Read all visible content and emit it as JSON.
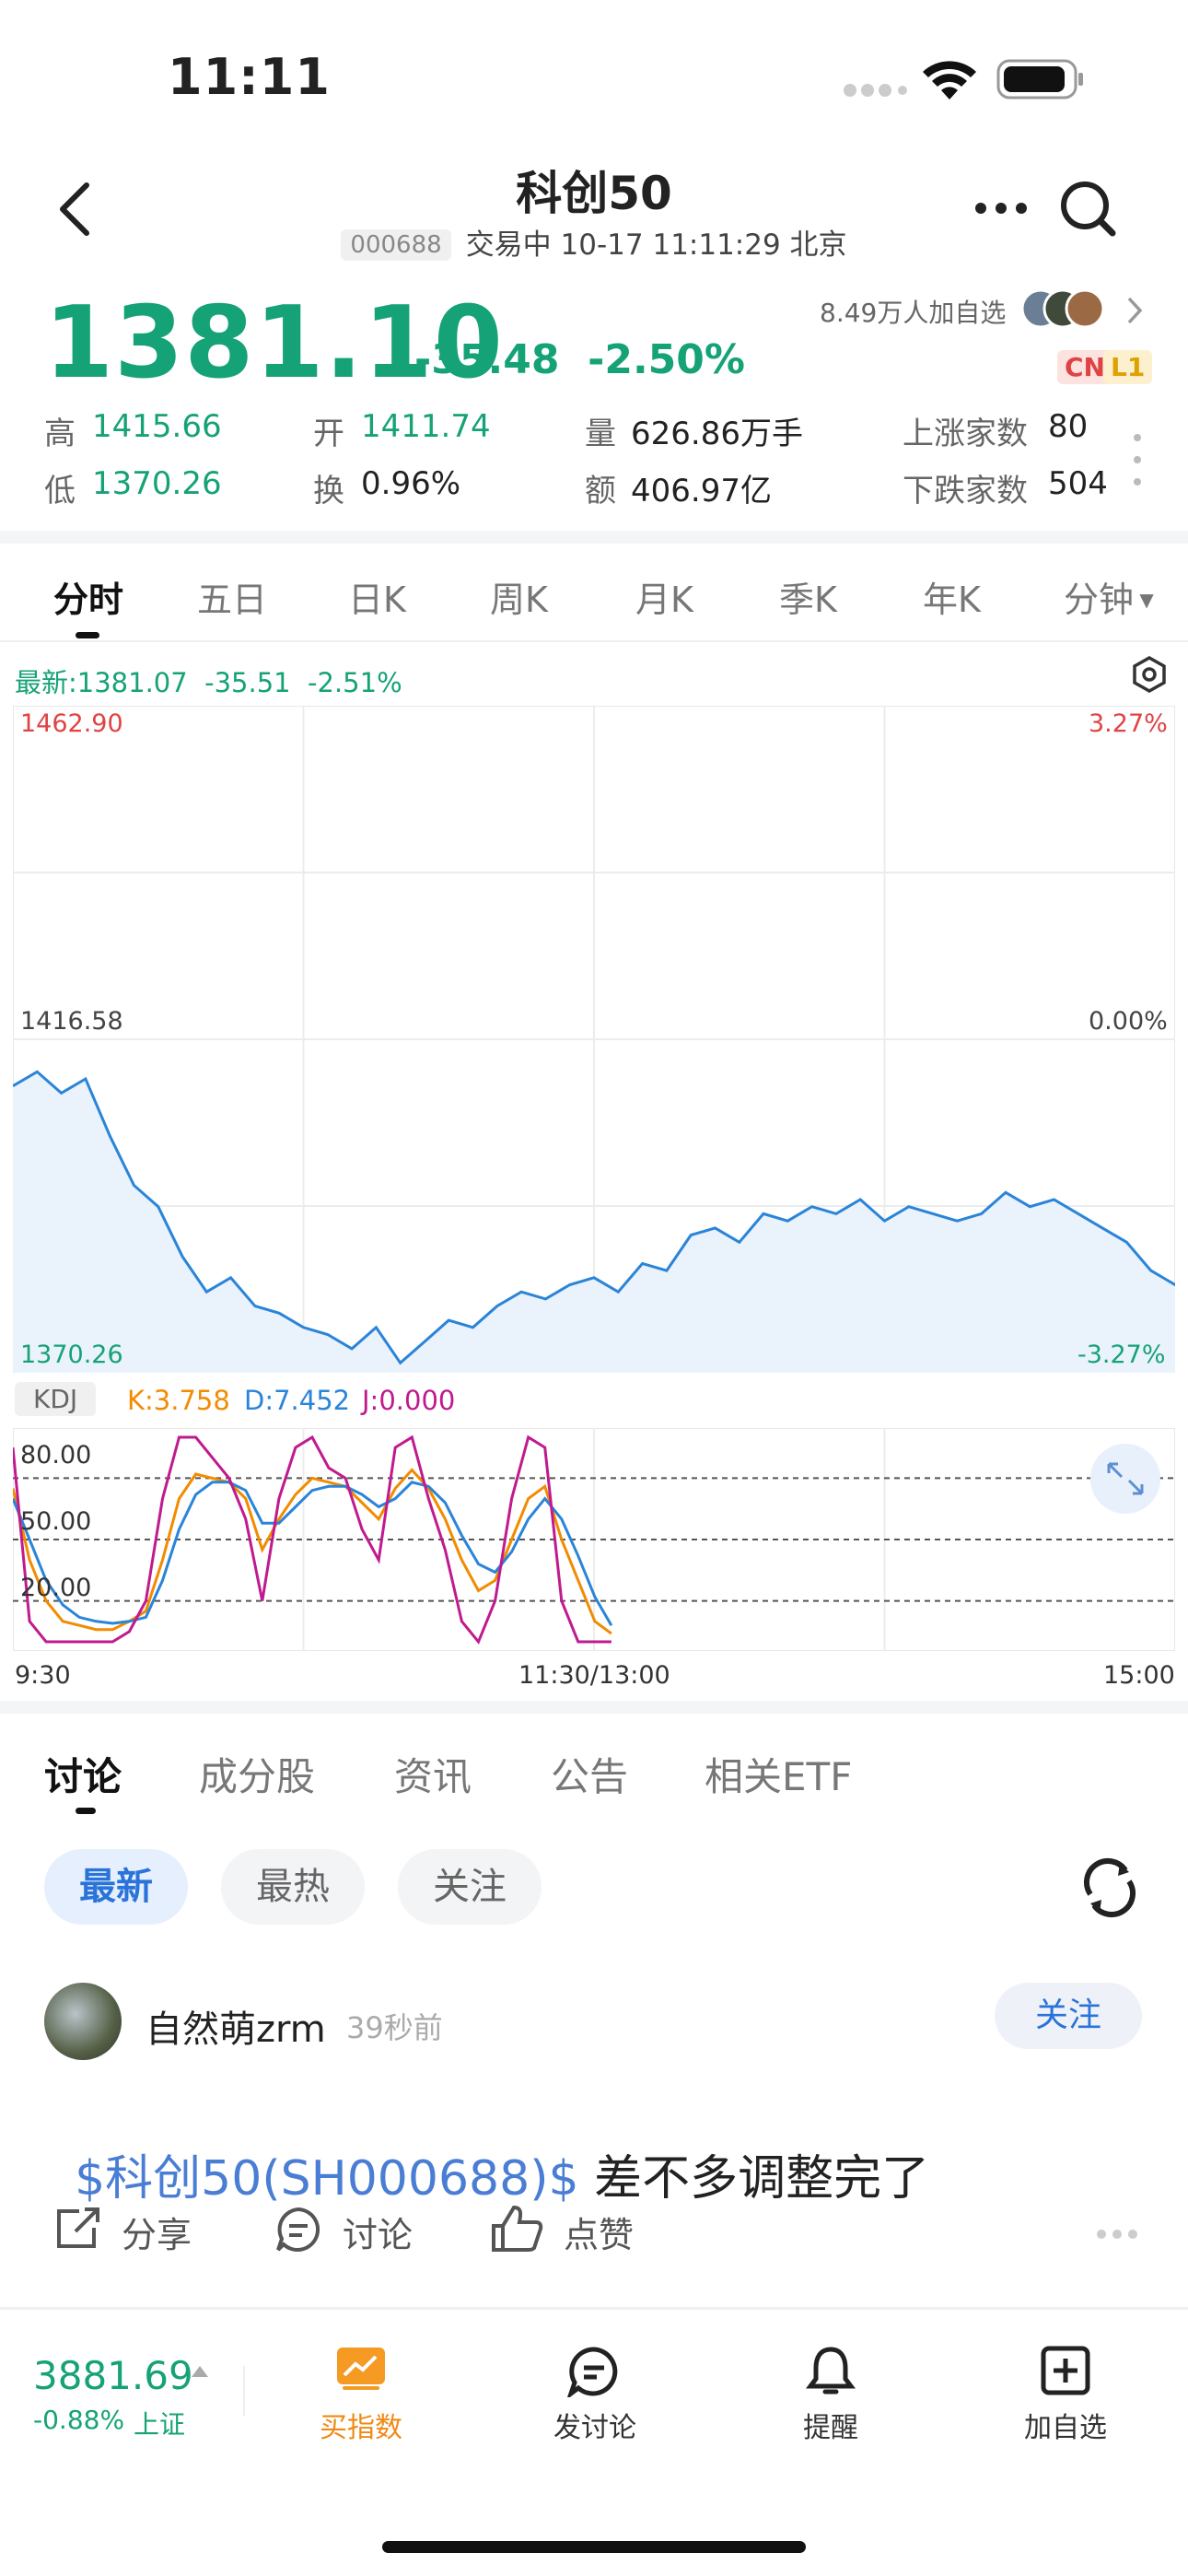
{
  "status_bar": {
    "time": "11:11"
  },
  "header": {
    "title": "科创50",
    "code": "000688",
    "status": "交易中 10-17 11:11:29 北京"
  },
  "quote": {
    "price": "1381.10",
    "change": "-35.48",
    "change_pct": "-2.50%",
    "watchers": "8.49万人加自选",
    "tag_cn": "CN",
    "tag_l1": "L1"
  },
  "stats": {
    "high_label": "高",
    "high": "1415.66",
    "open_label": "开",
    "open": "1411.74",
    "volume_label": "量",
    "volume": "626.86万手",
    "up_label": "上涨家数",
    "up": "80",
    "low_label": "低",
    "low": "1370.26",
    "turnover_label": "换",
    "turnover": "0.96%",
    "amount_label": "额",
    "amount": "406.97亿",
    "down_label": "下跌家数",
    "down": "504"
  },
  "chart_tabs": [
    "分时",
    "五日",
    "日K",
    "周K",
    "月K",
    "季K",
    "年K",
    "分钟"
  ],
  "chart_info": {
    "latest": "最新:1381.07  -35.51  -2.51%"
  },
  "chart_data": [
    {
      "type": "line",
      "y_labels_left": [
        "1462.90",
        "1416.58",
        "1370.26"
      ],
      "y_labels_right": [
        "3.27%",
        "0.00%",
        "-3.27%"
      ],
      "ylim": [
        1370.26,
        1462.9
      ],
      "x_labels": [
        "9:30",
        "11:30/13:00",
        "15:00"
      ],
      "series": [
        {
          "x": [
            0,
            2,
            4,
            6,
            8,
            10,
            12,
            14,
            16,
            18,
            20,
            22,
            24,
            26,
            28,
            30,
            32,
            34,
            36,
            38,
            40,
            42,
            44,
            46,
            48,
            50,
            52,
            54,
            56,
            58,
            60,
            62,
            64,
            66,
            68,
            70,
            72,
            74,
            76,
            78,
            80,
            82,
            84,
            86,
            88,
            90,
            92,
            94,
            96,
            98,
            100,
            102,
            104,
            106
          ],
          "values": [
            1410,
            1412,
            1409,
            1411,
            1403,
            1396,
            1393,
            1386,
            1381,
            1383,
            1379,
            1378,
            1376,
            1375,
            1373,
            1376,
            1371,
            1374,
            1377,
            1376,
            1379,
            1381,
            1380,
            1382,
            1383,
            1381,
            1385,
            1384,
            1389,
            1390,
            1388,
            1392,
            1391,
            1393,
            1392,
            1394,
            1391,
            1393,
            1392,
            1391,
            1392,
            1395,
            1393,
            1394,
            1392,
            1390,
            1388,
            1384,
            1382,
            1381,
            1381,
            1381,
            1381,
            1381
          ]
        }
      ]
    },
    {
      "type": "line",
      "title": "KDJ",
      "legend": [
        "K:3.758",
        "D:7.452",
        "J:0.000"
      ],
      "y_labels": [
        "80.00",
        "50.00",
        "20.00"
      ],
      "ylim": [
        0,
        100
      ],
      "series": [
        {
          "name": "K:3.758",
          "color": "#f28b00",
          "values": [
            75,
            40,
            20,
            10,
            8,
            6,
            6,
            10,
            15,
            40,
            70,
            82,
            80,
            78,
            70,
            45,
            60,
            72,
            80,
            78,
            76,
            68,
            60,
            75,
            84,
            75,
            60,
            40,
            25,
            30,
            50,
            70,
            76,
            50,
            30,
            10,
            4
          ]
        },
        {
          "name": "D:7.452",
          "color": "#2a84d8",
          "values": [
            70,
            50,
            30,
            18,
            12,
            10,
            9,
            10,
            12,
            30,
            55,
            72,
            78,
            78,
            74,
            58,
            58,
            66,
            74,
            76,
            76,
            72,
            66,
            70,
            78,
            76,
            68,
            52,
            38,
            34,
            44,
            60,
            70,
            60,
            42,
            22,
            8
          ]
        },
        {
          "name": "J:0.000",
          "color": "#c01a8f",
          "values": [
            95,
            10,
            0,
            0,
            0,
            0,
            0,
            5,
            20,
            70,
            100,
            100,
            90,
            80,
            60,
            20,
            70,
            95,
            100,
            85,
            80,
            55,
            40,
            95,
            100,
            70,
            45,
            10,
            0,
            20,
            70,
            100,
            95,
            20,
            0,
            0,
            0
          ]
        }
      ]
    }
  ],
  "sub_tabs": [
    "讨论",
    "成分股",
    "资讯",
    "公告",
    "相关ETF"
  ],
  "filter_chips": [
    "最新",
    "最热",
    "关注"
  ],
  "post": {
    "user": "自然萌zrm",
    "time": "39秒前",
    "follow": "关注",
    "link": "$科创50(SH000688)$",
    "text": " 差不多调整完了",
    "share": "分享",
    "discuss": "讨论",
    "like": "点赞"
  },
  "bottom_bar": {
    "index_value": "3881.69",
    "index_change": "-0.88%",
    "index_name": "上证",
    "items": [
      "买指数",
      "发讨论",
      "提醒",
      "加自选"
    ]
  }
}
